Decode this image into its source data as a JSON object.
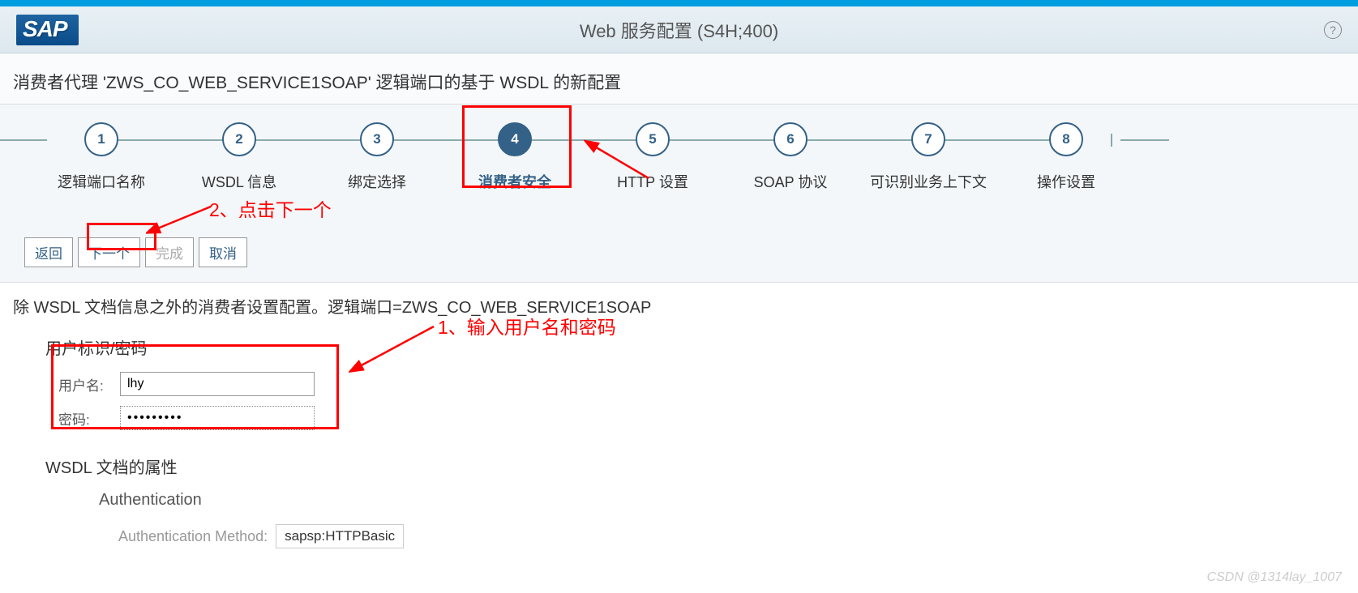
{
  "header": {
    "logo": "SAP",
    "title": "Web 服务配置 (S4H;400)",
    "help_tooltip": "?"
  },
  "sub_header": "消费者代理 'ZWS_CO_WEB_SERVICE1SOAP' 逻辑端口的基于 WSDL 的新配置",
  "wizard": {
    "steps": [
      {
        "num": "1",
        "label": "逻辑端口名称"
      },
      {
        "num": "2",
        "label": "WSDL 信息"
      },
      {
        "num": "3",
        "label": "绑定选择"
      },
      {
        "num": "4",
        "label": "消费者安全"
      },
      {
        "num": "5",
        "label": "HTTP 设置"
      },
      {
        "num": "6",
        "label": "SOAP 协议"
      },
      {
        "num": "7",
        "label": "可识别业务上下文"
      },
      {
        "num": "8",
        "label": "操作设置"
      }
    ],
    "active_index": 3
  },
  "buttons": {
    "back": "返回",
    "next": "下一个",
    "finish": "完成",
    "cancel": "取消"
  },
  "info_text": "除 WSDL 文档信息之外的消费者设置配置。逻辑端口=ZWS_CO_WEB_SERVICE1SOAP",
  "credentials": {
    "section_title": "用户标识/密码",
    "username_label": "用户名:",
    "username_value": "lhy",
    "password_label": "密码:",
    "password_value": "•••••••••"
  },
  "wsdl_section": {
    "title": "WSDL 文档的属性",
    "auth_title": "Authentication",
    "auth_method_label": "Authentication Method:",
    "auth_method_value": "sapsp:HTTPBasic"
  },
  "annotations": {
    "annot1": "1、输入用户名和密码",
    "annot2": "2、点击下一个"
  },
  "watermark": "CSDN @1314lay_1007"
}
